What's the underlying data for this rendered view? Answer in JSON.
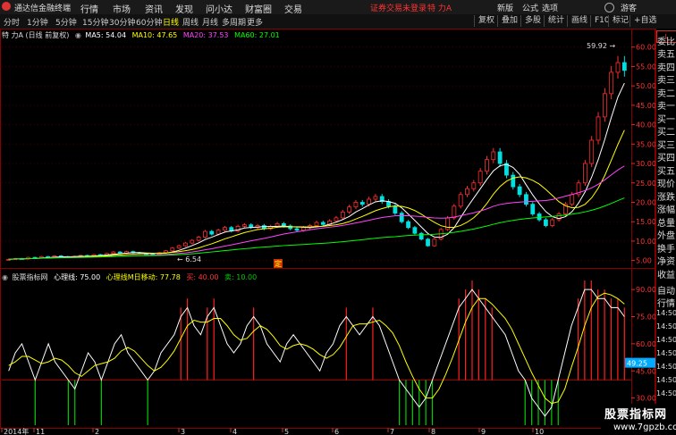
{
  "app": {
    "name": "通达信金融终端"
  },
  "menu": [
    "行情",
    "市场",
    "资讯",
    "发现",
    "问小达",
    "财富圈",
    "交易"
  ],
  "notice": "证券交易未登录",
  "stock_name": "特 力A",
  "top_right": [
    "新版",
    "公式",
    "选项",
    "游客"
  ],
  "timeframes": [
    "分时",
    "1分钟",
    "5分钟",
    "15分钟",
    "30分钟",
    "60分钟",
    "日线",
    "周线",
    "月线",
    "多周期",
    "更多"
  ],
  "timeframe_active": "日线",
  "right_buttons": [
    "复权",
    "叠加",
    "多股",
    "统计",
    "画线",
    "F10",
    "标记",
    "+自选"
  ],
  "chart_title": "特 力A (日线 前复权)",
  "ma": [
    {
      "label": "MA5: 54.04",
      "color": "#ffffff"
    },
    {
      "label": "MA10: 47.65",
      "color": "#ffff00"
    },
    {
      "label": "MA20: 37.53",
      "color": "#ff44ff"
    },
    {
      "label": "MA60: 27.01",
      "color": "#00ff00"
    }
  ],
  "indicator": {
    "name": "股票指标网",
    "line": "心理线: 75.00",
    "ma_line": "心理线M日移动: 77.78",
    "buy": "买: 40.00",
    "sell": "卖: 10.00"
  },
  "price_axis": [
    "60.00",
    "55.00",
    "50.00",
    "45.00",
    "40.00",
    "35.00",
    "30.00",
    "25.00",
    "20.00",
    "15.00",
    "10.00",
    "5.00"
  ],
  "ind_axis": [
    "90.00",
    "75.00",
    "60.00",
    "45.00",
    "30.00",
    "15.00"
  ],
  "ind_current": "49.25",
  "annotations": {
    "high": "59.92",
    "low": "6.54",
    "marker": "定"
  },
  "date_axis": [
    "2014年",
    "11",
    "2",
    "3",
    "4",
    "5",
    "6",
    "7",
    "8",
    "9",
    "10"
  ],
  "right_panel": [
    "委比",
    "卖五",
    "卖四",
    "卖三",
    "卖二",
    "卖一",
    "买一",
    "买二",
    "买三",
    "买四",
    "买五",
    "现价",
    "涨跌",
    "涨幅",
    "总量",
    "外盘",
    "换手",
    "净资",
    "收益",
    "自动",
    "行情",
    "14:50",
    "14:50",
    "14:50",
    "14:50",
    "14:50",
    "14:50",
    "14:50",
    "14:50"
  ],
  "watermark": {
    "line1": "股票指标网",
    "line2": "www.7gpzb.com"
  },
  "colors": {
    "up": "#ff3030",
    "down": "#00e0e0",
    "ma5": "#ffffff",
    "ma10": "#ffff00",
    "ma20": "#ff44ff",
    "ma60": "#00ff00",
    "buy": "#ff2020",
    "sell": "#00cc00"
  },
  "chart_data": {
    "type": "line",
    "price_ylim": [
      4,
      62
    ],
    "close": [
      5.3,
      5.5,
      5.4,
      5.8,
      5.6,
      6.0,
      5.8,
      6.2,
      6.0,
      5.9,
      6.1,
      6.3,
      6.1,
      6.5,
      6.4,
      6.8,
      7.2,
      6.9,
      7.3,
      7.0,
      6.8,
      6.7,
      6.54,
      7.0,
      7.5,
      8.2,
      8.8,
      9.5,
      10.2,
      11.0,
      12.5,
      11.8,
      12.8,
      13.5,
      12.6,
      13.8,
      14.2,
      13.5,
      14.0,
      13.2,
      13.8,
      14.5,
      13.9,
      13.2,
      12.8,
      13.5,
      14.0,
      14.8,
      14.3,
      15.2,
      16.0,
      17.5,
      18.8,
      20.0,
      19.5,
      20.8,
      21.5,
      20.2,
      19.0,
      17.2,
      15.0,
      13.5,
      12.0,
      10.5,
      8.8,
      10.5,
      13.0,
      16.0,
      19.0,
      22.0,
      23.5,
      25.0,
      28.0,
      31.0,
      33.0,
      30.0,
      27.0,
      24.0,
      22.0,
      19.5,
      17.0,
      15.5,
      14.0,
      15.5,
      17.0,
      19.5,
      22.0,
      25.0,
      30.0,
      36.0,
      42.0,
      48.0,
      53.5,
      56.0,
      54.0
    ],
    "ma20_x_unit": "bars",
    "indicator_ylim": [
      15,
      95
    ],
    "psy": [
      45,
      55,
      60,
      50,
      40,
      50,
      60,
      50,
      45,
      40,
      35,
      45,
      55,
      50,
      40,
      50,
      60,
      65,
      55,
      50,
      45,
      40,
      45,
      55,
      60,
      65,
      75,
      80,
      70,
      65,
      75,
      80,
      70,
      60,
      55,
      60,
      70,
      75,
      70,
      60,
      55,
      50,
      60,
      65,
      60,
      55,
      50,
      45,
      55,
      60,
      70,
      75,
      70,
      65,
      70,
      75,
      70,
      60,
      50,
      40,
      35,
      30,
      25,
      30,
      40,
      50,
      60,
      70,
      80,
      85,
      90,
      85,
      80,
      75,
      70,
      65,
      55,
      45,
      40,
      30,
      25,
      20,
      25,
      40,
      55,
      70,
      80,
      90,
      90,
      85,
      85,
      80,
      80,
      75
    ],
    "psy_ma": [
      48,
      50,
      53,
      53,
      51,
      49,
      50,
      52,
      51,
      48,
      44,
      42,
      45,
      48,
      49,
      50,
      52,
      56,
      58,
      56,
      52,
      48,
      45,
      47,
      51,
      56,
      63,
      70,
      73,
      72,
      72,
      74,
      74,
      70,
      65,
      62,
      63,
      67,
      70,
      68,
      64,
      59,
      57,
      59,
      60,
      59,
      57,
      54,
      52,
      54,
      58,
      64,
      70,
      71,
      71,
      72,
      73,
      70,
      66,
      59,
      50,
      42,
      35,
      30,
      30,
      35,
      43,
      52,
      62,
      72,
      80,
      85,
      85,
      82,
      78,
      74,
      68,
      60,
      52,
      44,
      37,
      30,
      27,
      28,
      35,
      47,
      58,
      70,
      80,
      86,
      88,
      87,
      85,
      82
    ]
  }
}
